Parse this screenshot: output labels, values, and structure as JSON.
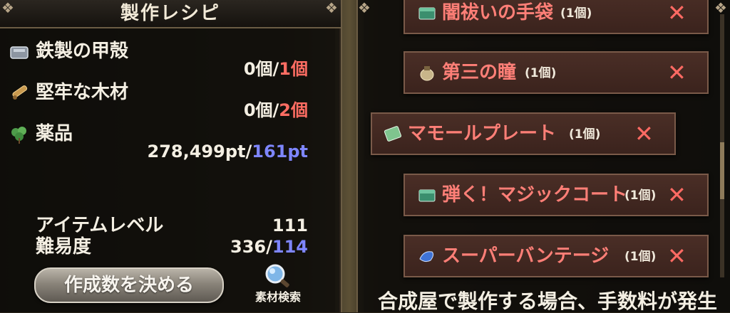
{
  "left_panel": {
    "title": "製作レシピ",
    "materials": [
      {
        "name": "鉄製の甲殻",
        "icon": "iron-shell-icon",
        "have": "0個",
        "sep": "/",
        "need": "1個"
      },
      {
        "name": "堅牢な木材",
        "icon": "wood-icon",
        "have": "0個",
        "sep": "/",
        "need": "2個"
      },
      {
        "name": "薬品",
        "icon": "herb-icon",
        "have": "278,499pt",
        "sep": "/",
        "need": "161pt"
      }
    ],
    "item_level_label": "アイテムレベル",
    "item_level_value": "111",
    "difficulty_label": "難易度",
    "difficulty_have": "336",
    "difficulty_sep": "/",
    "difficulty_need": "114",
    "make_button_label": "作成数を決める",
    "search_label": "素材検索"
  },
  "right_panel": {
    "items": [
      {
        "name": "闇祓いの手袋",
        "qty": "(1個)",
        "icon": "box-icon"
      },
      {
        "name": "第三の瞳",
        "qty": "(1個)",
        "icon": "pouch-icon"
      },
      {
        "name": "マモールプレート",
        "qty": "(1個)",
        "icon": "scroll-icon"
      },
      {
        "name": "弾く！マジックコート",
        "qty": "(1個)",
        "icon": "box-icon"
      },
      {
        "name": "スーパーバンテージ",
        "qty": "(1個)",
        "icon": "bandage-icon"
      }
    ],
    "remove_symbol": "✕",
    "footer_text": "合成屋で製作する場合、手数料が発生"
  },
  "colors": {
    "accent_red": "#ff6d63",
    "accent_blue": "#7e86ff",
    "panel_border": "#6b5c44"
  }
}
